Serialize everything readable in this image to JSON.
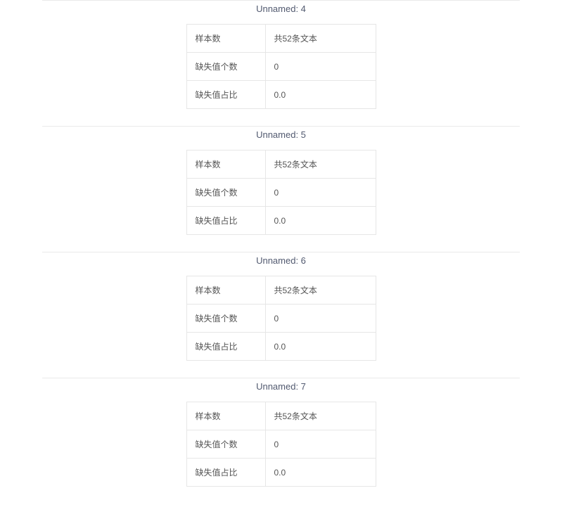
{
  "sections": [
    {
      "title": "Unnamed: 4",
      "rows": [
        {
          "label": "样本数",
          "value": "共52条文本"
        },
        {
          "label": "缺失值个数",
          "value": "0"
        },
        {
          "label": "缺失值占比",
          "value": "0.0"
        }
      ]
    },
    {
      "title": "Unnamed: 5",
      "rows": [
        {
          "label": "样本数",
          "value": "共52条文本"
        },
        {
          "label": "缺失值个数",
          "value": "0"
        },
        {
          "label": "缺失值占比",
          "value": "0.0"
        }
      ]
    },
    {
      "title": "Unnamed: 6",
      "rows": [
        {
          "label": "样本数",
          "value": "共52条文本"
        },
        {
          "label": "缺失值个数",
          "value": "0"
        },
        {
          "label": "缺失值占比",
          "value": "0.0"
        }
      ]
    },
    {
      "title": "Unnamed: 7",
      "rows": [
        {
          "label": "样本数",
          "value": "共52条文本"
        },
        {
          "label": "缺失值个数",
          "value": "0"
        },
        {
          "label": "缺失值占比",
          "value": "0.0"
        }
      ]
    }
  ]
}
